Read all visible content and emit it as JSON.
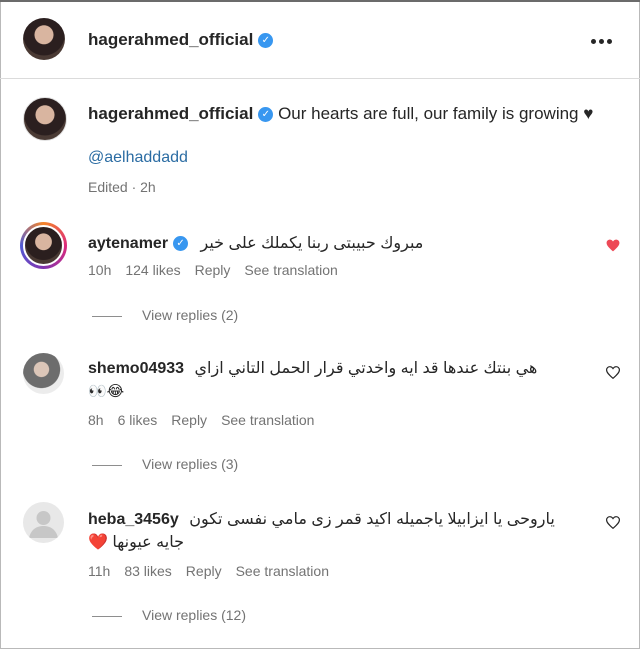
{
  "post": {
    "username": "hagerahmed_official",
    "caption": "Our hearts are full, our family is growing ♥",
    "mention": "@aelhaddadd",
    "edited": "Edited · 2h"
  },
  "comments": [
    {
      "username": "aytenamer",
      "verified": true,
      "text": "مبروك حبيبتى ربنا يكملك على خير",
      "time": "10h",
      "likes": "124 likes",
      "reply_label": "Reply",
      "translate_label": "See translation",
      "view_replies": "View replies (2)",
      "liked": true
    },
    {
      "username": "shemo04933",
      "verified": false,
      "text": "هي بنتك عندها قد ايه واخدتي قرار الحمل التاني ازاي",
      "emoji": "👀😂",
      "time": "8h",
      "likes": "6 likes",
      "reply_label": "Reply",
      "translate_label": "See translation",
      "view_replies": "View replies (3)",
      "liked": false
    },
    {
      "username": "heba_3456y",
      "verified": false,
      "text": "ياروحى يا ايزابيلا ياجميله اكيد قمر زى مامي نفسى تكون",
      "text2": "جايه عيونها ❤️",
      "time": "11h",
      "likes": "83 likes",
      "reply_label": "Reply",
      "translate_label": "See translation",
      "view_replies": "View replies (12)",
      "liked": false
    }
  ],
  "colors": {
    "verified": "#3897f0",
    "like": "#ed4956",
    "link": "#2b6ca3",
    "secondary_text": "#737373"
  }
}
